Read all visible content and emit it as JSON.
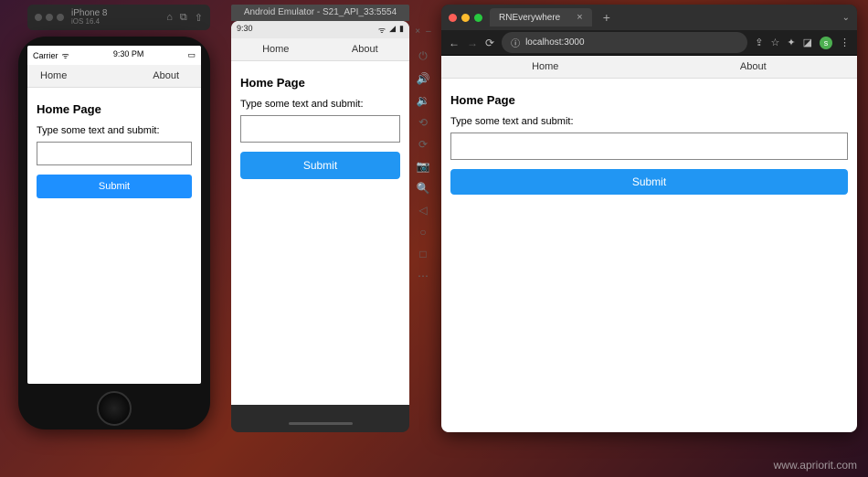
{
  "watermark": "www.apriorit.com",
  "iphone": {
    "sim_device": "iPhone 8",
    "sim_os": "iOS 16.4",
    "carrier": "Carrier",
    "time": "9:30 PM",
    "tab_home": "Home",
    "tab_about": "About"
  },
  "android": {
    "emulator_title": "Android Emulator - S21_API_33:5554",
    "time": "9:30",
    "tab_home": "Home",
    "tab_about": "About"
  },
  "browser": {
    "tab_title": "RNEverywhere",
    "url": "localhost:3000",
    "avatar_letter": "s",
    "tab_home": "Home",
    "tab_about": "About"
  },
  "app": {
    "heading": "Home Page",
    "prompt": "Type some text and submit:",
    "submit": "Submit"
  },
  "emu_toolbar": {
    "close": "×",
    "min": "–"
  }
}
